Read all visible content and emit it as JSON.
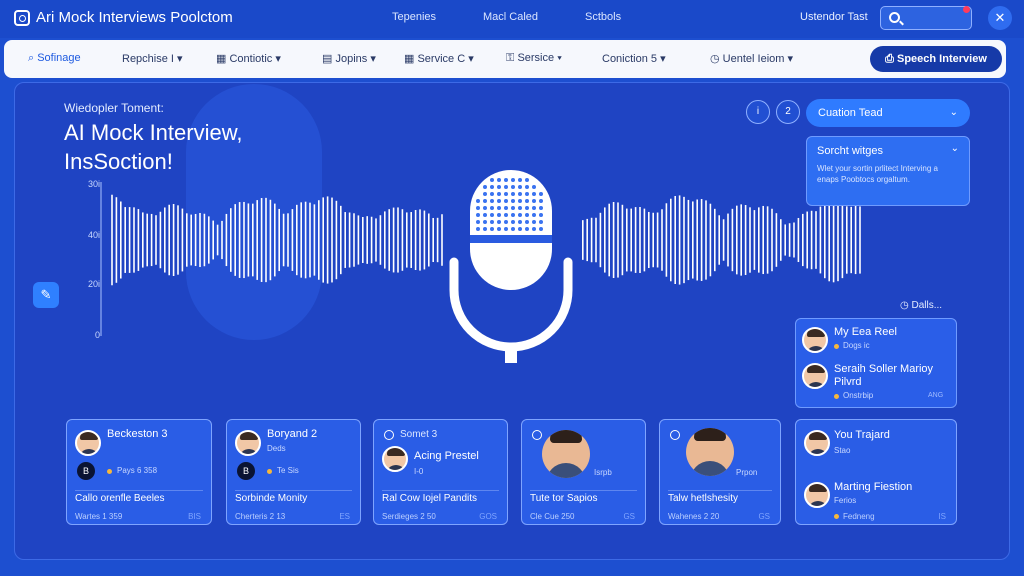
{
  "app": {
    "title": "Ari Mock Interviews Poolctom"
  },
  "nav": {
    "items": [
      "Tepenies",
      "Macl Caled",
      "Sctbols"
    ]
  },
  "user": {
    "name": "Ustendor Tast"
  },
  "toolbar": {
    "items": [
      "Sofinage",
      "Repchise I",
      "Contiotic",
      "Jopins",
      "Service C",
      "Sersice",
      "Coniction 5",
      "Uentel Ieiom"
    ],
    "speech_button": "Speech Interview"
  },
  "hero": {
    "subtitle": "Wiedopler Toment:",
    "title": "AI Mock Interview, InsSoction!",
    "y_ticks": [
      "30i",
      "40i",
      "20i",
      "0"
    ]
  },
  "right_panel": {
    "icons": [
      "i",
      "2"
    ],
    "dropdown_label": "Cuation Tead",
    "info_title": "Sorcht witges",
    "info_text": "Wlet your sortin prlitect Interving a enaps Poobtocs orgaltum.",
    "dates_label": "Dalls...",
    "list": [
      {
        "title": "My Eea Reel",
        "sub": "Dogs ic"
      },
      {
        "title": "Seraih Soller Marioy Pilvrd",
        "sub": "Onstrbip",
        "tag": "ANG"
      }
    ]
  },
  "cards": [
    {
      "title": "Beckeston 3",
      "sub": "Pays 6 358",
      "badge": "B",
      "bottom": "Callo orenfle Beeles",
      "meta": "Wartes 1 359",
      "tag": "BIS"
    },
    {
      "title": "Boryand 2",
      "sub": "Deds",
      "sub2": "Te Sis",
      "badge": "B",
      "bottom": "Sorbinde Monity",
      "meta": "Cherteris 2 13",
      "tag": "ES"
    },
    {
      "title": "Somet 3",
      "sub": "Acing Prestel",
      "sub2": "I-0",
      "bottom": "Ral Cow Iojel Pandits",
      "meta": "Serdieges 2 50",
      "tag": "GOS"
    },
    {
      "title": "",
      "sub": "Isrpb",
      "bottom": "Tute tor Sapios",
      "meta": "Cle Cue 250",
      "tag": "GS"
    },
    {
      "title": "",
      "sub": "Prpon",
      "bottom": "Talw hetlshesity",
      "meta": "Wahenes 2 20",
      "tag": "GS"
    },
    {
      "title": "You Trajard",
      "sub": "Stao",
      "title2": "Marting Fiestion",
      "sub2": "Ferios",
      "meta": "Fedneng",
      "tag": "IS"
    }
  ]
}
